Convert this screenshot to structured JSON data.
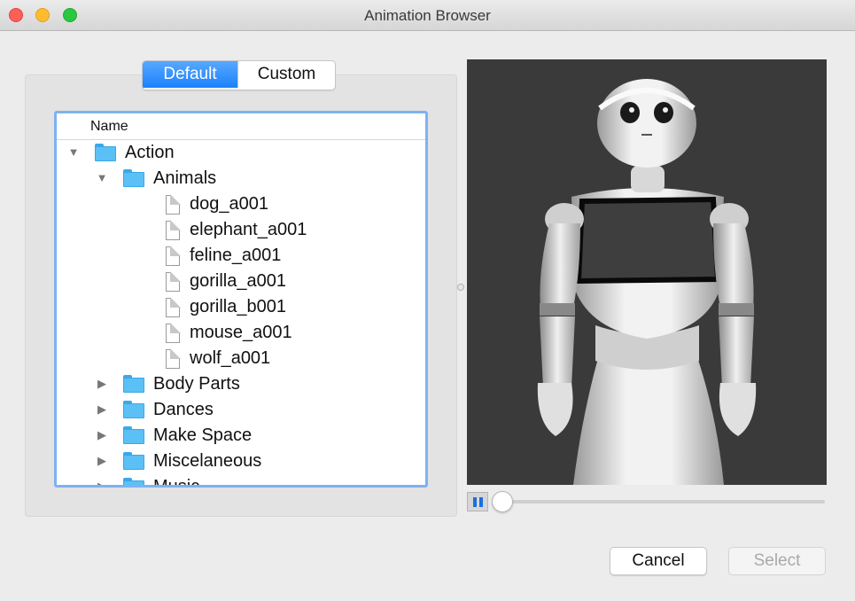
{
  "window": {
    "title": "Animation Browser"
  },
  "tabs": {
    "default_label": "Default",
    "custom_label": "Custom",
    "selected": "Default"
  },
  "tree": {
    "column_header": "Name",
    "rows": [
      {
        "label": "Action",
        "type": "folder",
        "depth": 0,
        "expanded": true
      },
      {
        "label": "Animals",
        "type": "folder",
        "depth": 1,
        "expanded": true
      },
      {
        "label": "dog_a001",
        "type": "file",
        "depth": 2
      },
      {
        "label": "elephant_a001",
        "type": "file",
        "depth": 2
      },
      {
        "label": "feline_a001",
        "type": "file",
        "depth": 2
      },
      {
        "label": "gorilla_a001",
        "type": "file",
        "depth": 2
      },
      {
        "label": "gorilla_b001",
        "type": "file",
        "depth": 2
      },
      {
        "label": "mouse_a001",
        "type": "file",
        "depth": 2
      },
      {
        "label": "wolf_a001",
        "type": "file",
        "depth": 2
      },
      {
        "label": "Body Parts",
        "type": "folder",
        "depth": 1,
        "expanded": false
      },
      {
        "label": "Dances",
        "type": "folder",
        "depth": 1,
        "expanded": false
      },
      {
        "label": "Make Space",
        "type": "folder",
        "depth": 1,
        "expanded": false
      },
      {
        "label": "Miscelaneous",
        "type": "folder",
        "depth": 1,
        "expanded": false
      },
      {
        "label": "Music",
        "type": "folder",
        "depth": 1,
        "expanded": false
      }
    ]
  },
  "preview": {
    "playback_state": "playing",
    "progress": 0.0
  },
  "buttons": {
    "cancel_label": "Cancel",
    "select_label": "Select",
    "select_enabled": false
  },
  "colors": {
    "accent": "#1a82fb",
    "viewport_bg": "#3a3a3a",
    "focus_ring": "#7db2f2"
  }
}
